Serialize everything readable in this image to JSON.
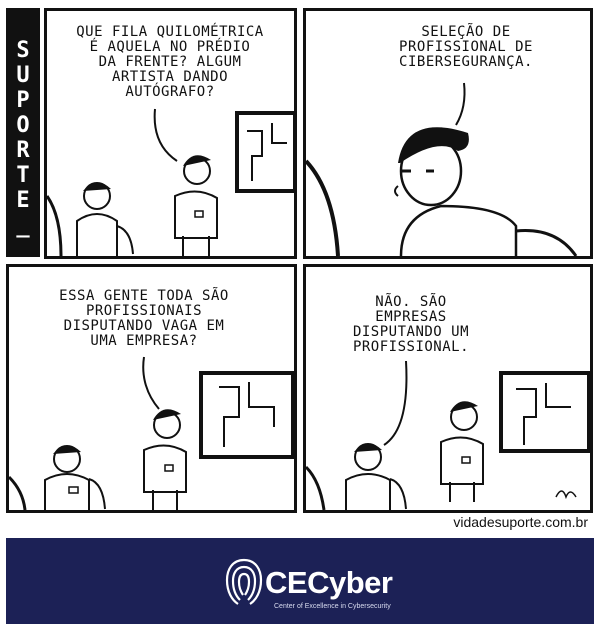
{
  "comic": {
    "side_title": "SUPORTE_",
    "panels": [
      {
        "speech": "QUE FILA QUILOMÉTRICA\nÉ AQUELA NO PRÉDIO\nDA FRENTE? ALGUM\nARTISTA DANDO\nAUTÓGRAFO?"
      },
      {
        "speech": "SELEÇÃO DE\nPROFISSIONAL DE\nCIBERSEGURANÇA."
      },
      {
        "speech": "ESSA GENTE TODA SÃO\nPROFISSIONAIS\nDISPUTANDO VAGA EM\nUMA EMPRESA?"
      },
      {
        "speech": "NÃO. SÃO\nEMPRESAS\nDISPUTANDO UM\nPROFISSIONAL."
      }
    ],
    "credit": "vidadesuporte.com.br"
  },
  "banner": {
    "brand": "CECyber",
    "tagline": "Center of Excellence in Cybersecurity",
    "background_color": "#1c2156"
  }
}
